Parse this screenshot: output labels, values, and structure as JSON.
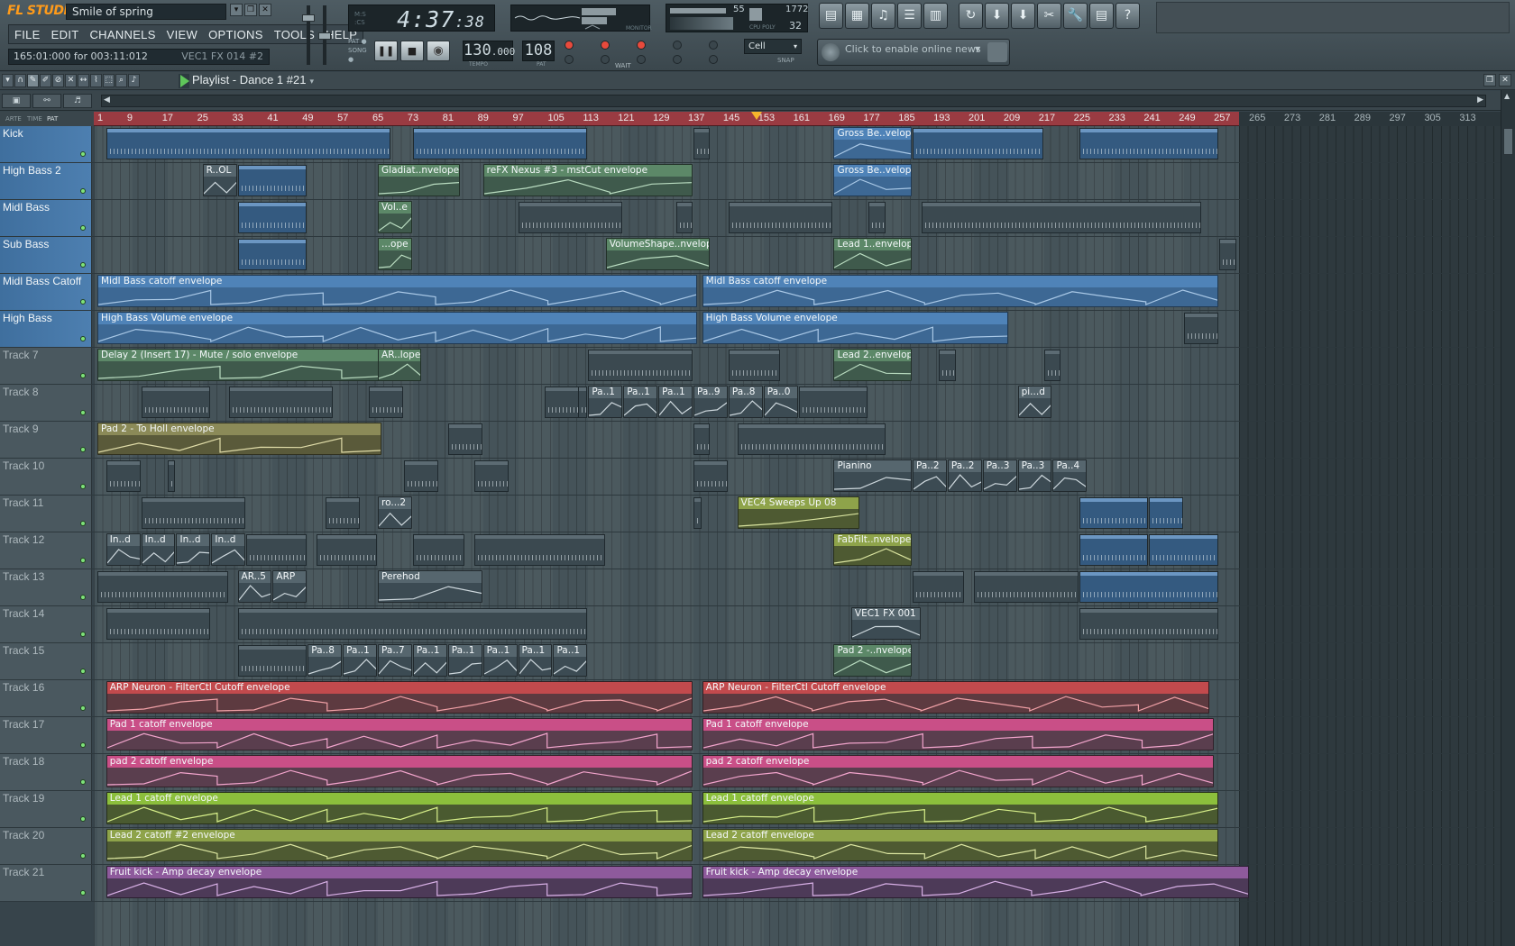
{
  "app": {
    "logo": "FL STUDIO",
    "song_title": "Smile of spring",
    "menu": [
      "FILE",
      "EDIT",
      "CHANNELS",
      "VIEW",
      "OPTIONS",
      "TOOLS",
      "HELP"
    ],
    "hint_left": "165:01:000 for 003:11:012",
    "hint_right": "VEC1 FX 014 #2",
    "time_big": "4:37",
    "time_small": ":38",
    "pat_label": "PAT",
    "song_label": "SONG",
    "tempo": "130",
    "tempo_dec": ".000",
    "tempo_label": "TEMPO",
    "pattern_num": "108",
    "pattern_label": "PAT",
    "monitor_label": "MONITOR",
    "cpu_value": "55",
    "ram_value": "1772",
    "poly_value": "32",
    "cpu_labels": "CPU  POLY",
    "snap_value": "Cell",
    "snap_label": "SNAP",
    "wait_label": "WAIT",
    "news_text": "Click to enable online news",
    "tool_icons": [
      "playlist-icon",
      "step-sequencer-icon",
      "piano-roll-icon",
      "browser-icon",
      "mixer-icon",
      "undo-icon",
      "save-icon",
      "save-as-icon",
      "cut-icon",
      "wrench-icon",
      "sheet-icon",
      "help-icon"
    ],
    "tool_glyphs": [
      "▤",
      "▦",
      "♫",
      "☰",
      "▥",
      "↻",
      "⬇",
      "⬇",
      "✂",
      "🔧",
      "▤",
      "?"
    ]
  },
  "playlist": {
    "title": "Playlist - Dance 1 #21",
    "sub_labels": [
      "ARTE",
      "TIME",
      "PAT"
    ],
    "ruler_ticks": [
      "1",
      "9",
      "17",
      "25",
      "33",
      "41",
      "49",
      "57",
      "65",
      "73",
      "81",
      "89",
      "97",
      "105",
      "113",
      "121",
      "129",
      "137",
      "145",
      "153",
      "161",
      "169",
      "177",
      "185",
      "193",
      "201",
      "209",
      "217",
      "225",
      "233",
      "241",
      "249",
      "257",
      "265",
      "273",
      "281",
      "289",
      "297",
      "305",
      "313"
    ],
    "tracks": [
      {
        "name": "Kick",
        "style": "blue"
      },
      {
        "name": "High Bass 2",
        "style": "blue"
      },
      {
        "name": "Midl Bass",
        "style": "blue"
      },
      {
        "name": "Sub Bass",
        "style": "blue"
      },
      {
        "name": "Midl Bass Catoff",
        "style": "blue"
      },
      {
        "name": "High Bass",
        "style": "blue"
      },
      {
        "name": "Track 7",
        "style": "gray"
      },
      {
        "name": "Track 8",
        "style": "gray"
      },
      {
        "name": "Track 9",
        "style": "gray"
      },
      {
        "name": "Track 10",
        "style": "gray"
      },
      {
        "name": "Track 11",
        "style": "gray"
      },
      {
        "name": "Track 12",
        "style": "gray"
      },
      {
        "name": "Track 13",
        "style": "gray"
      },
      {
        "name": "Track 14",
        "style": "gray"
      },
      {
        "name": "Track 15",
        "style": "gray"
      },
      {
        "name": "Track 16",
        "style": "gray"
      },
      {
        "name": "Track 17",
        "style": "gray"
      },
      {
        "name": "Track 18",
        "style": "gray"
      },
      {
        "name": "Track 19",
        "style": "gray"
      },
      {
        "name": "Track 20",
        "style": "gray"
      },
      {
        "name": "Track 21",
        "style": "gray"
      }
    ],
    "clips": [
      {
        "track": 0,
        "bar": 169,
        "len": 18,
        "label": "Gross Be..velope",
        "color": "blue"
      },
      {
        "track": 1,
        "bar": 25,
        "len": 8,
        "label": "R..OL",
        "color": "steel"
      },
      {
        "track": 1,
        "bar": 65,
        "len": 19,
        "label": "Gladiat..nvelope",
        "color": "green"
      },
      {
        "track": 1,
        "bar": 89,
        "len": 48,
        "label": "reFX Nexus #3 - mstCut envelope",
        "color": "green"
      },
      {
        "track": 1,
        "bar": 169,
        "len": 18,
        "label": "Gross Be..velope",
        "color": "blue"
      },
      {
        "track": 2,
        "bar": 65,
        "len": 8,
        "label": "Vol..e",
        "color": "green"
      },
      {
        "track": 3,
        "bar": 65,
        "len": 8,
        "label": "...ope",
        "color": "green"
      },
      {
        "track": 3,
        "bar": 117,
        "len": 24,
        "label": "VolumeShape..nvelope",
        "color": "green"
      },
      {
        "track": 3,
        "bar": 169,
        "len": 18,
        "label": "Lead 1..envelope",
        "color": "green"
      },
      {
        "track": 4,
        "bar": 1,
        "len": 137,
        "label": "Midl Bass catoff envelope",
        "color": "blue"
      },
      {
        "track": 4,
        "bar": 139,
        "len": 118,
        "label": "Midl Bass catoff envelope",
        "color": "blue"
      },
      {
        "track": 5,
        "bar": 1,
        "len": 137,
        "label": "High Bass Volume envelope",
        "color": "blue"
      },
      {
        "track": 5,
        "bar": 139,
        "len": 70,
        "label": "High Bass Volume envelope",
        "color": "blue"
      },
      {
        "track": 6,
        "bar": 1,
        "len": 65,
        "label": "Delay 2 (Insert 17) - Mute / solo envelope",
        "color": "green"
      },
      {
        "track": 6,
        "bar": 65,
        "len": 10,
        "label": "AR..lope",
        "color": "green"
      },
      {
        "track": 6,
        "bar": 169,
        "len": 18,
        "label": "Lead 2..envelope",
        "color": "green"
      },
      {
        "track": 8,
        "bar": 1,
        "len": 65,
        "label": "Pad 2 - To Holl envelope",
        "color": "olive"
      },
      {
        "track": 9,
        "bar": 169,
        "len": 18,
        "label": "Pianino",
        "color": "steel"
      },
      {
        "track": 9,
        "bar": 187,
        "len": 8,
        "label": "Pa..2",
        "color": "steel"
      },
      {
        "track": 9,
        "bar": 195,
        "len": 8,
        "label": "Pa..2",
        "color": "steel"
      },
      {
        "track": 9,
        "bar": 203,
        "len": 8,
        "label": "Pa..3",
        "color": "steel"
      },
      {
        "track": 9,
        "bar": 211,
        "len": 8,
        "label": "Pa..3",
        "color": "steel"
      },
      {
        "track": 9,
        "bar": 219,
        "len": 8,
        "label": "Pa..4",
        "color": "steel"
      },
      {
        "track": 10,
        "bar": 65,
        "len": 8,
        "label": "ro...2",
        "color": "steel"
      },
      {
        "track": 10,
        "bar": 147,
        "len": 28,
        "label": "VEC4 Sweeps Up 08",
        "color": "ylime"
      },
      {
        "track": 11,
        "bar": 169,
        "len": 18,
        "label": "FabFilt..nvelope",
        "color": "ylime"
      },
      {
        "track": 11,
        "bar": 3,
        "len": 8,
        "label": "In..d",
        "color": "steel"
      },
      {
        "track": 11,
        "bar": 11,
        "len": 8,
        "label": "In..d",
        "color": "steel"
      },
      {
        "track": 11,
        "bar": 19,
        "len": 8,
        "label": "In..d",
        "color": "steel"
      },
      {
        "track": 11,
        "bar": 27,
        "len": 8,
        "label": "In..d",
        "color": "steel"
      },
      {
        "track": 12,
        "bar": 33,
        "len": 8,
        "label": "AR..5",
        "color": "steel"
      },
      {
        "track": 12,
        "bar": 41,
        "len": 8,
        "label": "ARP",
        "color": "steel"
      },
      {
        "track": 12,
        "bar": 65,
        "len": 24,
        "label": "Perehod",
        "color": "steel"
      },
      {
        "track": 13,
        "bar": 173,
        "len": 16,
        "label": "VEC1 FX 001",
        "color": "steel"
      },
      {
        "track": 14,
        "bar": 169,
        "len": 18,
        "label": "Pad 2 -..nvelope",
        "color": "green"
      },
      {
        "track": 14,
        "bar": 49,
        "len": 8,
        "label": "Pa..8",
        "color": "steel"
      },
      {
        "track": 14,
        "bar": 57,
        "len": 8,
        "label": "Pa..1",
        "color": "steel"
      },
      {
        "track": 14,
        "bar": 65,
        "len": 8,
        "label": "Pa..7",
        "color": "steel"
      },
      {
        "track": 14,
        "bar": 73,
        "len": 8,
        "label": "Pa..1",
        "color": "steel"
      },
      {
        "track": 14,
        "bar": 81,
        "len": 8,
        "label": "Pa..1",
        "color": "steel"
      },
      {
        "track": 14,
        "bar": 89,
        "len": 8,
        "label": "Pa..1",
        "color": "steel"
      },
      {
        "track": 14,
        "bar": 97,
        "len": 8,
        "label": "Pa..1",
        "color": "steel"
      },
      {
        "track": 14,
        "bar": 105,
        "len": 8,
        "label": "Pa..1",
        "color": "steel"
      },
      {
        "track": 7,
        "bar": 113,
        "len": 8,
        "label": "Pa..1",
        "color": "steel"
      },
      {
        "track": 7,
        "bar": 121,
        "len": 8,
        "label": "Pa..1",
        "color": "steel"
      },
      {
        "track": 7,
        "bar": 129,
        "len": 8,
        "label": "Pa..1",
        "color": "steel"
      },
      {
        "track": 7,
        "bar": 137,
        "len": 8,
        "label": "Pa..9",
        "color": "steel"
      },
      {
        "track": 7,
        "bar": 145,
        "len": 8,
        "label": "Pa..8",
        "color": "steel"
      },
      {
        "track": 7,
        "bar": 153,
        "len": 8,
        "label": "Pa..0",
        "color": "steel"
      },
      {
        "track": 7,
        "bar": 211,
        "len": 8,
        "label": "pi...d",
        "color": "steel"
      },
      {
        "track": 15,
        "bar": 3,
        "len": 134,
        "label": "ARP Neuron - FilterCtl Cutoff envelope",
        "color": "red"
      },
      {
        "track": 15,
        "bar": 139,
        "len": 116,
        "label": "ARP Neuron - FilterCtl Cutoff envelope",
        "color": "red"
      },
      {
        "track": 16,
        "bar": 3,
        "len": 134,
        "label": "Pad 1 catoff envelope",
        "color": "pink"
      },
      {
        "track": 16,
        "bar": 139,
        "len": 117,
        "label": "Pad 1 catoff envelope",
        "color": "pink"
      },
      {
        "track": 17,
        "bar": 3,
        "len": 134,
        "label": "pad 2 catoff envelope",
        "color": "pink"
      },
      {
        "track": 17,
        "bar": 139,
        "len": 117,
        "label": "pad 2 catoff envelope",
        "color": "pink"
      },
      {
        "track": 18,
        "bar": 3,
        "len": 134,
        "label": "Lead 1 catoff envelope",
        "color": "lime"
      },
      {
        "track": 18,
        "bar": 139,
        "len": 118,
        "label": "Lead 1 catoff envelope",
        "color": "lime"
      },
      {
        "track": 19,
        "bar": 3,
        "len": 134,
        "label": "Lead 2 catoff #2 envelope",
        "color": "ylime"
      },
      {
        "track": 19,
        "bar": 139,
        "len": 118,
        "label": "Lead 2 catoff envelope",
        "color": "ylime"
      },
      {
        "track": 20,
        "bar": 3,
        "len": 134,
        "label": "Fruit kick - Amp decay envelope",
        "color": "purple"
      },
      {
        "track": 20,
        "bar": 139,
        "len": 125,
        "label": "Fruit kick - Amp decay envelope",
        "color": "purple"
      }
    ],
    "patterns": [
      {
        "track": 0,
        "bar": 3,
        "len": 65,
        "color": "blue"
      },
      {
        "track": 0,
        "bar": 73,
        "len": 40,
        "color": "blue"
      },
      {
        "track": 0,
        "bar": 137,
        "len": 4
      },
      {
        "track": 0,
        "bar": 187,
        "len": 30,
        "color": "blue"
      },
      {
        "track": 0,
        "bar": 225,
        "len": 32,
        "color": "blue"
      },
      {
        "track": 1,
        "bar": 33,
        "len": 16,
        "color": "blue"
      },
      {
        "track": 2,
        "bar": 33,
        "len": 16,
        "color": "blue"
      },
      {
        "track": 2,
        "bar": 97,
        "len": 24
      },
      {
        "track": 2,
        "bar": 133,
        "len": 4
      },
      {
        "track": 2,
        "bar": 145,
        "len": 24
      },
      {
        "track": 2,
        "bar": 177,
        "len": 4
      },
      {
        "track": 2,
        "bar": 189,
        "len": 64
      },
      {
        "track": 3,
        "bar": 33,
        "len": 16,
        "color": "blue"
      },
      {
        "track": 3,
        "bar": 257,
        "len": 4
      },
      {
        "track": 5,
        "bar": 249,
        "len": 8
      },
      {
        "track": 6,
        "bar": 113,
        "len": 24
      },
      {
        "track": 6,
        "bar": 145,
        "len": 12
      },
      {
        "track": 6,
        "bar": 193,
        "len": 4
      },
      {
        "track": 6,
        "bar": 217,
        "len": 4
      },
      {
        "track": 7,
        "bar": 11,
        "len": 16
      },
      {
        "track": 7,
        "bar": 31,
        "len": 24
      },
      {
        "track": 7,
        "bar": 63,
        "len": 8
      },
      {
        "track": 7,
        "bar": 109,
        "len": 4
      },
      {
        "track": 7,
        "bar": 161,
        "len": 16
      },
      {
        "track": 8,
        "bar": 81,
        "len": 8
      },
      {
        "track": 8,
        "bar": 137,
        "len": 4
      },
      {
        "track": 8,
        "bar": 147,
        "len": 34
      },
      {
        "track": 9,
        "bar": 3,
        "len": 8
      },
      {
        "track": 9,
        "bar": 17,
        "len": 2
      },
      {
        "track": 9,
        "bar": 71,
        "len": 8
      },
      {
        "track": 9,
        "bar": 87,
        "len": 8
      },
      {
        "track": 9,
        "bar": 137,
        "len": 8
      },
      {
        "track": 10,
        "bar": 11,
        "len": 24
      },
      {
        "track": 10,
        "bar": 53,
        "len": 8
      },
      {
        "track": 10,
        "bar": 137,
        "len": 2
      },
      {
        "track": 10,
        "bar": 225,
        "len": 16,
        "color": "blue"
      },
      {
        "track": 10,
        "bar": 241,
        "len": 8,
        "color": "blue"
      },
      {
        "track": 11,
        "bar": 35,
        "len": 14
      },
      {
        "track": 11,
        "bar": 51,
        "len": 14
      },
      {
        "track": 11,
        "bar": 73,
        "len": 12
      },
      {
        "track": 11,
        "bar": 87,
        "len": 30
      },
      {
        "track": 11,
        "bar": 225,
        "len": 16,
        "color": "blue"
      },
      {
        "track": 11,
        "bar": 241,
        "len": 16,
        "color": "blue"
      },
      {
        "track": 12,
        "bar": 1,
        "len": 30
      },
      {
        "track": 12,
        "bar": 187,
        "len": 12
      },
      {
        "track": 12,
        "bar": 201,
        "len": 24
      },
      {
        "track": 12,
        "bar": 225,
        "len": 32,
        "color": "blue"
      },
      {
        "track": 13,
        "bar": 3,
        "len": 24
      },
      {
        "track": 13,
        "bar": 33,
        "len": 80
      },
      {
        "track": 13,
        "bar": 225,
        "len": 32
      },
      {
        "track": 14,
        "bar": 33,
        "len": 16
      },
      {
        "track": 7,
        "bar": 103,
        "len": 8
      }
    ]
  },
  "colors": {
    "ruler_red": "#9a3b42",
    "track_blue": "#4d7fb0",
    "playhead": "#f5b52b"
  }
}
